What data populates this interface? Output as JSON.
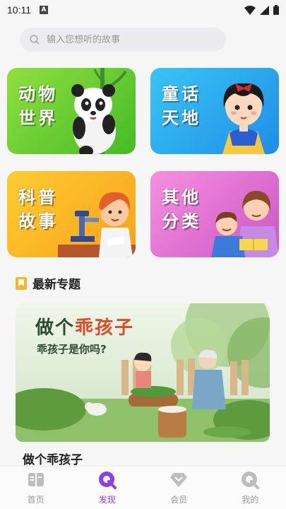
{
  "status_bar": {
    "time": "10:11"
  },
  "search": {
    "placeholder": "输入您想听的故事"
  },
  "categories": [
    {
      "title": "动物世界",
      "color": "#5bc82d"
    },
    {
      "title": "童话天地",
      "color": "#2ba6ee"
    },
    {
      "title": "科普故事",
      "color": "#f9b625"
    },
    {
      "title": "其他分类",
      "color": "#de6ed3"
    }
  ],
  "section": {
    "label": "最新专题",
    "icon": "bookmark-icon",
    "icon_color": "#f5b623"
  },
  "featured": {
    "banner_title_plain": "做个",
    "banner_title_highlight": "乖孩子",
    "banner_subtitle": "乖孩子是你吗?",
    "caption": "做个乖孩子"
  },
  "bottom_nav": [
    {
      "label": "首页",
      "icon": "book-icon",
      "active": false
    },
    {
      "label": "发现",
      "icon": "discover-icon",
      "active": true
    },
    {
      "label": "会员",
      "icon": "diamond-icon",
      "active": false
    },
    {
      "label": "我的",
      "icon": "profile-icon",
      "active": false
    }
  ],
  "colors": {
    "accent": "#8b3fe8",
    "inactive": "#999999"
  }
}
